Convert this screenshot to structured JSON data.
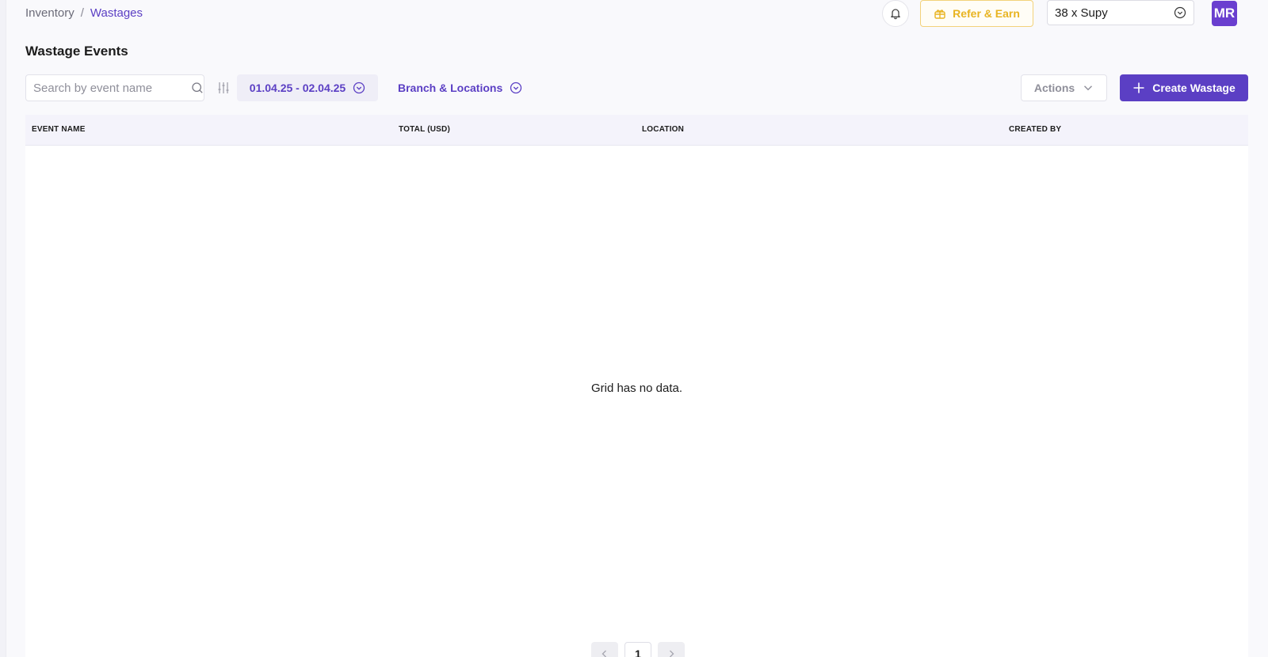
{
  "breadcrumb": {
    "parent": "Inventory",
    "separator": "/",
    "current": "Wastages"
  },
  "header": {
    "notification_icon": "bell-icon",
    "refer": {
      "label": "Refer & Earn",
      "icon": "gift-icon"
    },
    "company_select": {
      "value": "38 x Supy",
      "icon": "chevron-down-circle-icon"
    },
    "avatar": {
      "initials": "MR"
    }
  },
  "page": {
    "title": "Wastage Events"
  },
  "toolbar": {
    "search": {
      "value": "",
      "placeholder": "Search by event name",
      "icon": "search-icon"
    },
    "filter_icon": "sliders-icon",
    "date_range": {
      "label": "01.04.25 - 02.04.25",
      "icon": "chevron-down-circle-icon"
    },
    "branch_filter": {
      "label": "Branch & Locations",
      "icon": "chevron-down-circle-icon"
    },
    "actions": {
      "label": "Actions",
      "icon": "chevron-down-icon"
    },
    "create": {
      "label": "Create Wastage",
      "icon": "plus-icon"
    }
  },
  "grid": {
    "columns": [
      "EVENT NAME",
      "TOTAL (USD)",
      "LOCATION",
      "CREATED BY"
    ],
    "rows": [],
    "empty_message": "Grid has no data."
  },
  "pagination": {
    "current_page": "1"
  },
  "colors": {
    "accent": "#5b3fc4",
    "avatar": "#6a3fcf",
    "refer": "#e8b422",
    "header_bg": "#f4f3fb"
  }
}
